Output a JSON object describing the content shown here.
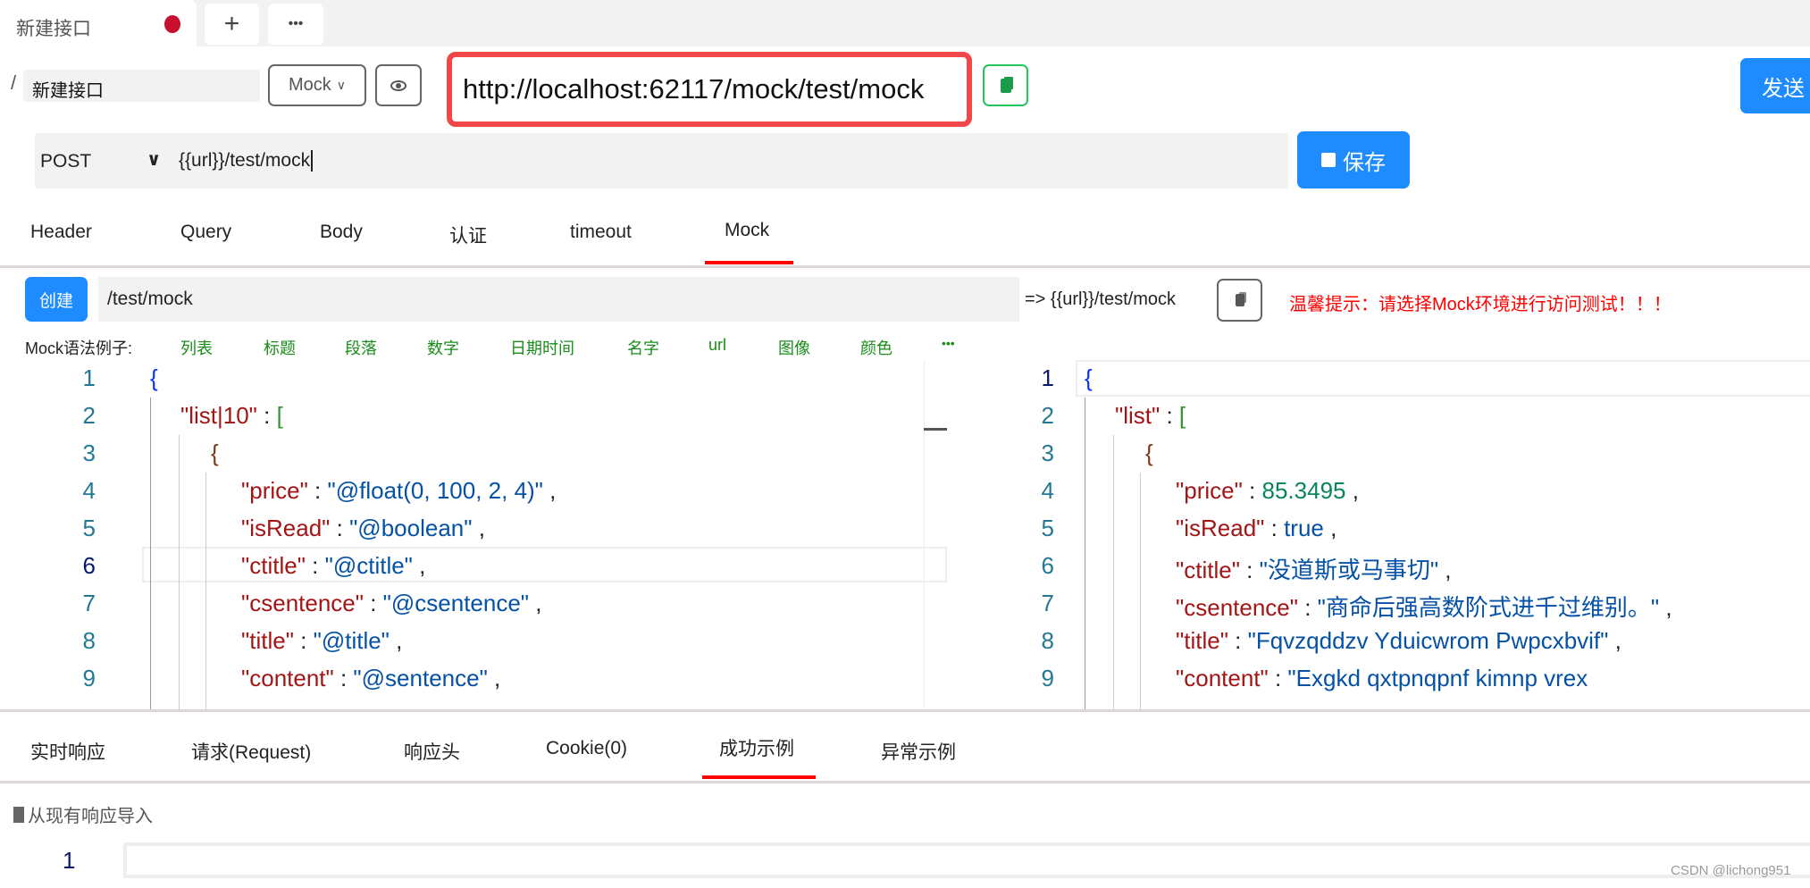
{
  "tabbar": {
    "active_tab": "新建接口",
    "add_label": "+",
    "more_label": "•••"
  },
  "request": {
    "breadcrumb_sep": "/",
    "name": "新建接口",
    "env_select": "Mock",
    "mock_url": "http://localhost:62117/mock/test/mock",
    "send_label": "发送",
    "method": "POST",
    "url": "{{url}}/test/mock",
    "save_label": "保存"
  },
  "tabs": [
    {
      "label": "Header"
    },
    {
      "label": "Query"
    },
    {
      "label": "Body"
    },
    {
      "label": "认证"
    },
    {
      "label": "timeout"
    },
    {
      "label": "Mock",
      "active": true
    }
  ],
  "mock": {
    "create_label": "创建",
    "path": "/test/mock",
    "resolved": "=> {{url}}/test/mock",
    "tip": "温馨提示：请选择Mock环境进行访问测试！！！",
    "examples_label": "Mock语法例子:",
    "examples": [
      "列表",
      "标题",
      "段落",
      "数字",
      "日期时间",
      "名字",
      "url",
      "图像",
      "颜色",
      "•••"
    ]
  },
  "left_editor": {
    "lines": [
      [
        [
          "b1",
          "{"
        ]
      ],
      [
        [
          "k",
          "\"list|10\""
        ],
        [
          "p",
          " : "
        ],
        [
          "b2",
          "["
        ]
      ],
      [
        [
          "b3",
          "{"
        ]
      ],
      [
        [
          "k",
          "\"price\""
        ],
        [
          "p",
          " : "
        ],
        [
          "s",
          "\"@float(0, 100, 2, 4)\""
        ],
        [
          "p",
          " ,"
        ]
      ],
      [
        [
          "k",
          "\"isRead\""
        ],
        [
          "p",
          " : "
        ],
        [
          "s",
          "\"@boolean\""
        ],
        [
          "p",
          " ,"
        ]
      ],
      [
        [
          "k",
          "\"ctitle\""
        ],
        [
          "p",
          " : "
        ],
        [
          "s",
          "\"@ctitle\""
        ],
        [
          "p",
          " ,"
        ]
      ],
      [
        [
          "k",
          "\"csentence\""
        ],
        [
          "p",
          " : "
        ],
        [
          "s",
          "\"@csentence\""
        ],
        [
          "p",
          " ,"
        ]
      ],
      [
        [
          "k",
          "\"title\""
        ],
        [
          "p",
          " : "
        ],
        [
          "s",
          "\"@title\""
        ],
        [
          "p",
          " ,"
        ]
      ],
      [
        [
          "k",
          "\"content\""
        ],
        [
          "p",
          " : "
        ],
        [
          "s",
          "\"@sentence\""
        ],
        [
          "p",
          " ,"
        ]
      ]
    ]
  },
  "right_editor": {
    "lines": [
      [
        [
          "b1",
          "{"
        ]
      ],
      [
        [
          "k",
          "\"list\""
        ],
        [
          "p",
          " : "
        ],
        [
          "b2",
          "["
        ]
      ],
      [
        [
          "b3",
          "{"
        ]
      ],
      [
        [
          "k",
          "\"price\""
        ],
        [
          "p",
          " : "
        ],
        [
          "n",
          "85.3495"
        ],
        [
          "p",
          " ,"
        ]
      ],
      [
        [
          "k",
          "\"isRead\""
        ],
        [
          "p",
          " : "
        ],
        [
          "s",
          "true"
        ],
        [
          "p",
          " ,"
        ]
      ],
      [
        [
          "k",
          "\"ctitle\""
        ],
        [
          "p",
          " : "
        ],
        [
          "s",
          "\"没道斯或马事切\""
        ],
        [
          "p",
          " ,"
        ]
      ],
      [
        [
          "k",
          "\"csentence\""
        ],
        [
          "p",
          " : "
        ],
        [
          "s",
          "\"商命后强高数阶式进千过维别。\""
        ],
        [
          "p",
          " ,"
        ]
      ],
      [
        [
          "k",
          "\"title\""
        ],
        [
          "p",
          " : "
        ],
        [
          "s",
          "\"Fqvzqddzv Yduicwrom Pwpcxbvif\""
        ],
        [
          "p",
          " ,"
        ]
      ],
      [
        [
          "k",
          "\"content\""
        ],
        [
          "p",
          " : "
        ],
        [
          "s",
          "\"Exgkd qxtpnqpnf kimnp vrex"
        ]
      ]
    ]
  },
  "indent": [
    0,
    1,
    2,
    3,
    3,
    3,
    3,
    3,
    3
  ],
  "response_tabs": [
    {
      "label": "实时响应"
    },
    {
      "label": "请求(Request)"
    },
    {
      "label": "响应头"
    },
    {
      "label": "Cookie(0)"
    },
    {
      "label": "成功示例",
      "active": true
    },
    {
      "label": "异常示例"
    }
  ],
  "import_label": "从现有响应导入",
  "bottom_editor": {
    "line_number": "1"
  },
  "watermark": "CSDN @lichong951",
  "colors": {
    "accent": "#1e8cff",
    "active_tab_underline": "#ff0000",
    "highlight_border": "#f04848",
    "tip": "#ff0000",
    "examples": "#1a8c1a"
  }
}
